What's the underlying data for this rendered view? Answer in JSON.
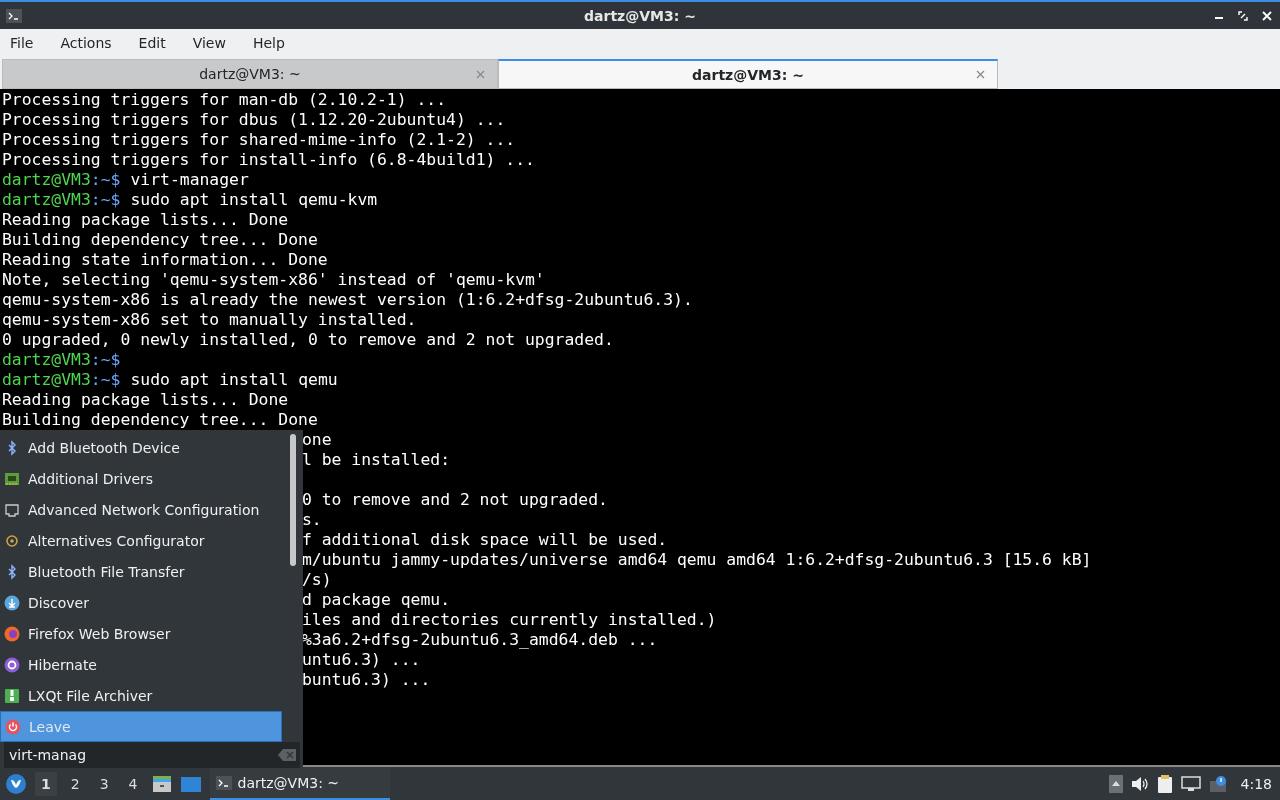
{
  "window": {
    "title": "dartz@VM3: ~"
  },
  "menubar": [
    "File",
    "Actions",
    "Edit",
    "View",
    "Help"
  ],
  "tabs": [
    {
      "label": "dartz@VM3: ~",
      "selected": false
    },
    {
      "label": "dartz@VM3: ~",
      "selected": true
    }
  ],
  "terminal": [
    {
      "kind": "out",
      "text": "Processing triggers for man-db (2.10.2-1) ..."
    },
    {
      "kind": "out",
      "text": "Processing triggers for dbus (1.12.20-2ubuntu4) ..."
    },
    {
      "kind": "out",
      "text": "Processing triggers for shared-mime-info (2.1-2) ..."
    },
    {
      "kind": "out",
      "text": "Processing triggers for install-info (6.8-4build1) ..."
    },
    {
      "kind": "prompt",
      "prompt": "dartz@VM3",
      "path": ":~$",
      "text": "virt-manager"
    },
    {
      "kind": "prompt",
      "prompt": "dartz@VM3",
      "path": ":~$",
      "text": "sudo apt install qemu-kvm"
    },
    {
      "kind": "out",
      "text": "Reading package lists... Done"
    },
    {
      "kind": "out",
      "text": "Building dependency tree... Done"
    },
    {
      "kind": "out",
      "text": "Reading state information... Done"
    },
    {
      "kind": "out",
      "text": "Note, selecting 'qemu-system-x86' instead of 'qemu-kvm'"
    },
    {
      "kind": "out",
      "text": "qemu-system-x86 is already the newest version (1:6.2+dfsg-2ubuntu6.3)."
    },
    {
      "kind": "out",
      "text": "qemu-system-x86 set to manually installed."
    },
    {
      "kind": "out",
      "text": "0 upgraded, 0 newly installed, 0 to remove and 2 not upgraded."
    },
    {
      "kind": "prompt",
      "prompt": "dartz@VM3",
      "path": ":~$"
    },
    {
      "kind": "prompt",
      "prompt": "dartz@VM3",
      "path": ":~$",
      "text": "sudo apt install qemu"
    },
    {
      "kind": "out",
      "text": "Reading package lists... Done"
    },
    {
      "kind": "out",
      "text": "Building dependency tree... Done"
    },
    {
      "kind": "covered",
      "text": "one"
    },
    {
      "kind": "covered",
      "text": "l be installed:"
    },
    {
      "kind": "blank"
    },
    {
      "kind": "covered",
      "text": "0 to remove and 2 not upgraded."
    },
    {
      "kind": "covered",
      "text": "s."
    },
    {
      "kind": "covered",
      "text": "f additional disk space will be used."
    },
    {
      "kind": "covered",
      "text": "m/ubuntu jammy-updates/universe amd64 qemu amd64 1:6.2+dfsg-2ubuntu6.3 [15.6 kB]"
    },
    {
      "kind": "covered",
      "text": "/s)"
    },
    {
      "kind": "covered",
      "text": "d package qemu."
    },
    {
      "kind": "covered",
      "text": "iles and directories currently installed.)"
    },
    {
      "kind": "covered",
      "text": "%3a6.2+dfsg-2ubuntu6.3_amd64.deb ..."
    },
    {
      "kind": "covered",
      "text": "untu6.3) ..."
    },
    {
      "kind": "covered",
      "text": "buntu6.3) ..."
    }
  ],
  "app_menu": {
    "items": [
      {
        "label": "Add Bluetooth Device",
        "selected": false
      },
      {
        "label": "Additional Drivers",
        "selected": false
      },
      {
        "label": "Advanced Network Configuration",
        "selected": false
      },
      {
        "label": "Alternatives Configurator",
        "selected": false
      },
      {
        "label": "Bluetooth File Transfer",
        "selected": false
      },
      {
        "label": "Discover",
        "selected": false
      },
      {
        "label": "Firefox Web Browser",
        "selected": false
      },
      {
        "label": "Hibernate",
        "selected": false
      },
      {
        "label": "LXQt File Archiver",
        "selected": false
      },
      {
        "label": "Leave",
        "selected": true
      }
    ],
    "search": {
      "value": "virt-manag"
    }
  },
  "taskbar": {
    "workspaces": [
      {
        "label": "1",
        "selected": true
      },
      {
        "label": "2",
        "selected": false
      },
      {
        "label": "3",
        "selected": false
      },
      {
        "label": "4",
        "selected": false
      }
    ],
    "task": {
      "label": "dartz@VM3: ~",
      "selected": true
    },
    "clock": "4:18"
  }
}
